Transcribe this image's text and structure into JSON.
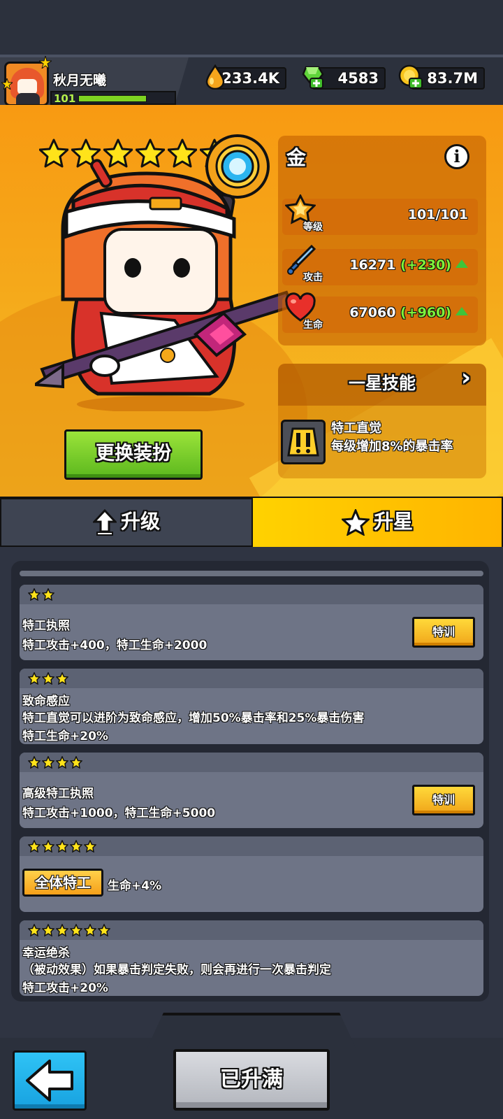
{
  "player": {
    "name": "秋月无曦",
    "level": "101",
    "exp_fraction": 0.72
  },
  "currencies": [
    {
      "icon": "oil-drop-icon",
      "value": "233.4K"
    },
    {
      "icon": "green-gem-plus-icon",
      "value": "4583"
    },
    {
      "icon": "gold-coin-plus-icon",
      "value": "83.7M"
    }
  ],
  "hero": {
    "stars": 6,
    "name": "金",
    "stats": {
      "level": {
        "label": "等级",
        "value": "101/101"
      },
      "attack": {
        "label": "攻击",
        "value": "16271",
        "bonus": "(+230)"
      },
      "hp": {
        "label": "生命",
        "value": "67060",
        "bonus": "(+960)"
      }
    },
    "skill": {
      "header": "一星技能",
      "name": "特工直觉",
      "desc": "每级增加8%的暴击率"
    },
    "change_outfit": "更换装扮"
  },
  "tabs": {
    "upgrade": "升级",
    "star_up": "升星"
  },
  "star_list": [
    {
      "stars": 2,
      "lines": [
        "特工执照",
        "特工攻击+400，特工生命+2000"
      ],
      "button": "特训"
    },
    {
      "stars": 3,
      "lines": [
        "致命感应",
        "特工直觉可以进阶为致命感应，增加50%暴击率和25%暴击伤害",
        "特工生命+20%"
      ]
    },
    {
      "stars": 4,
      "lines": [
        "高级特工执照",
        "特工攻击+1000，特工生命+5000"
      ],
      "button": "特训"
    },
    {
      "stars": 5,
      "tag": "全体特工",
      "lines": [
        "生命+4%"
      ]
    },
    {
      "stars": 6,
      "lines": [
        "幸运绝杀",
        "（被动效果）如果暴击判定失败，则会再进行一次暴击判定",
        "特工攻击+20%"
      ]
    }
  ],
  "bottom": {
    "max_label": "已升满"
  },
  "colors": {
    "accent_orange": "#f89a12",
    "accent_yellow": "#ffd200",
    "green": "#7ed321",
    "blue": "#18a2e0"
  }
}
